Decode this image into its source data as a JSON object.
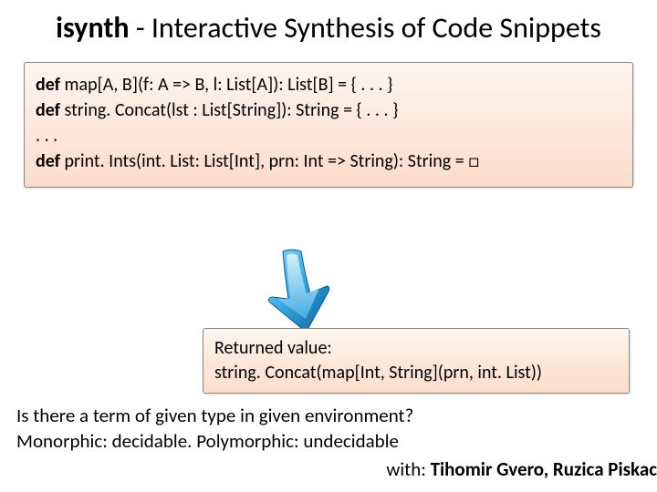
{
  "title": {
    "bold": "isynth",
    "rest": " - Interactive Synthesis of Code Snippets"
  },
  "code": {
    "l1_kw": "def",
    "l1_rest": " map[A, B](f: A => B, l: List[A]): List[B] = { . . . }",
    "l2_kw": "def",
    "l2_rest": " string. Concat(lst : List[String]): String = { . . . }",
    "l3": ". . .",
    "l4_kw": "def",
    "l4_rest": " print. Ints(int. List: List[Int], prn: Int => String): String = □"
  },
  "result": {
    "l1": "Returned value:",
    "l2": "string. Concat(map[Int, String](prn, int. List))"
  },
  "footer": {
    "l1": "Is there a term of given type in given environment?",
    "l2": "Monorphic: decidable.  Polymorphic: undecidable",
    "credit_prefix": "with: ",
    "credit_names": "Tihomir Gvero, Ruzica Piskac"
  },
  "icons": {
    "arrow": "down-right-arrow-icon"
  }
}
